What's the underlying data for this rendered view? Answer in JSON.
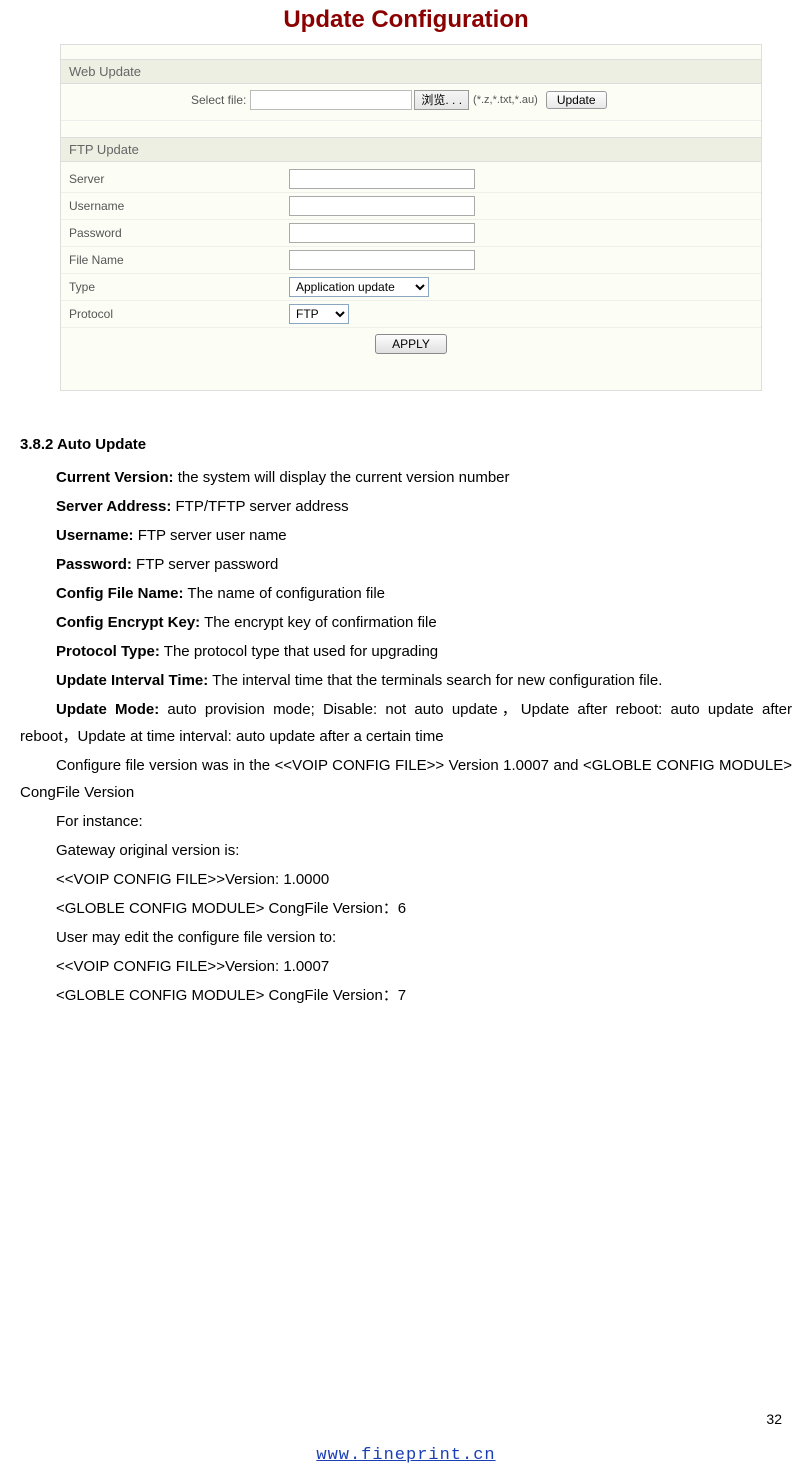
{
  "page_title": "Update Configuration",
  "web_update": {
    "section_label": "Web Update",
    "select_file_label": "Select file:",
    "browse_label": "浏览. . .",
    "hint": "(*.z,*.txt,*.au)",
    "update_label": "Update"
  },
  "ftp_update": {
    "section_label": "FTP Update",
    "rows": {
      "server": "Server",
      "username": "Username",
      "password": "Password",
      "filename": "File Name",
      "type_label": "Type",
      "type_value": "Application update",
      "protocol_label": "Protocol",
      "protocol_value": "FTP"
    },
    "apply_label": "APPLY"
  },
  "doc": {
    "heading": "3.8.2 Auto Update",
    "items": [
      {
        "label": "Current Version:",
        "text": " the system will display the current version number"
      },
      {
        "label": "Server Address:",
        "text": " FTP/TFTP server address"
      },
      {
        "label": "Username:",
        "text": " FTP server user name"
      },
      {
        "label": "Password:",
        "text": " FTP server password"
      },
      {
        "label": "Config File Name:",
        "text": " The name of configuration file"
      },
      {
        "label": "Config Encrypt Key:",
        "text": " The encrypt key of confirmation file"
      },
      {
        "label": "Protocol Type:",
        "text": " The protocol type that used for upgrading"
      }
    ],
    "interval_label": "Update Interval Time:",
    "interval_text": " The interval time that the terminals search for new configuration file.",
    "mode_label": "Update Mode:",
    "mode_text": " auto provision mode; Disable: not auto update，Update after reboot: auto update after reboot，Update at time interval: auto update after a certain time",
    "conf_line": "Configure file version was in the <<VOIP CONFIG FILE>> Version 1.0007 and <GLOBLE CONFIG MODULE> CongFile Version",
    "for_instance": "For instance:",
    "orig_header": "Gateway original version is:",
    "orig1": "<<VOIP CONFIG FILE>>Version: 1.0000",
    "orig2": "<GLOBLE CONFIG MODULE>   CongFile Version：6",
    "edit_header": "User may edit the configure file version to:",
    "edit1": "<<VOIP CONFIG FILE>>Version: 1.0007",
    "edit2": "<GLOBLE CONFIG MODULE>   CongFile Version：7"
  },
  "page_number": "32",
  "footer": "www.fineprint.cn"
}
